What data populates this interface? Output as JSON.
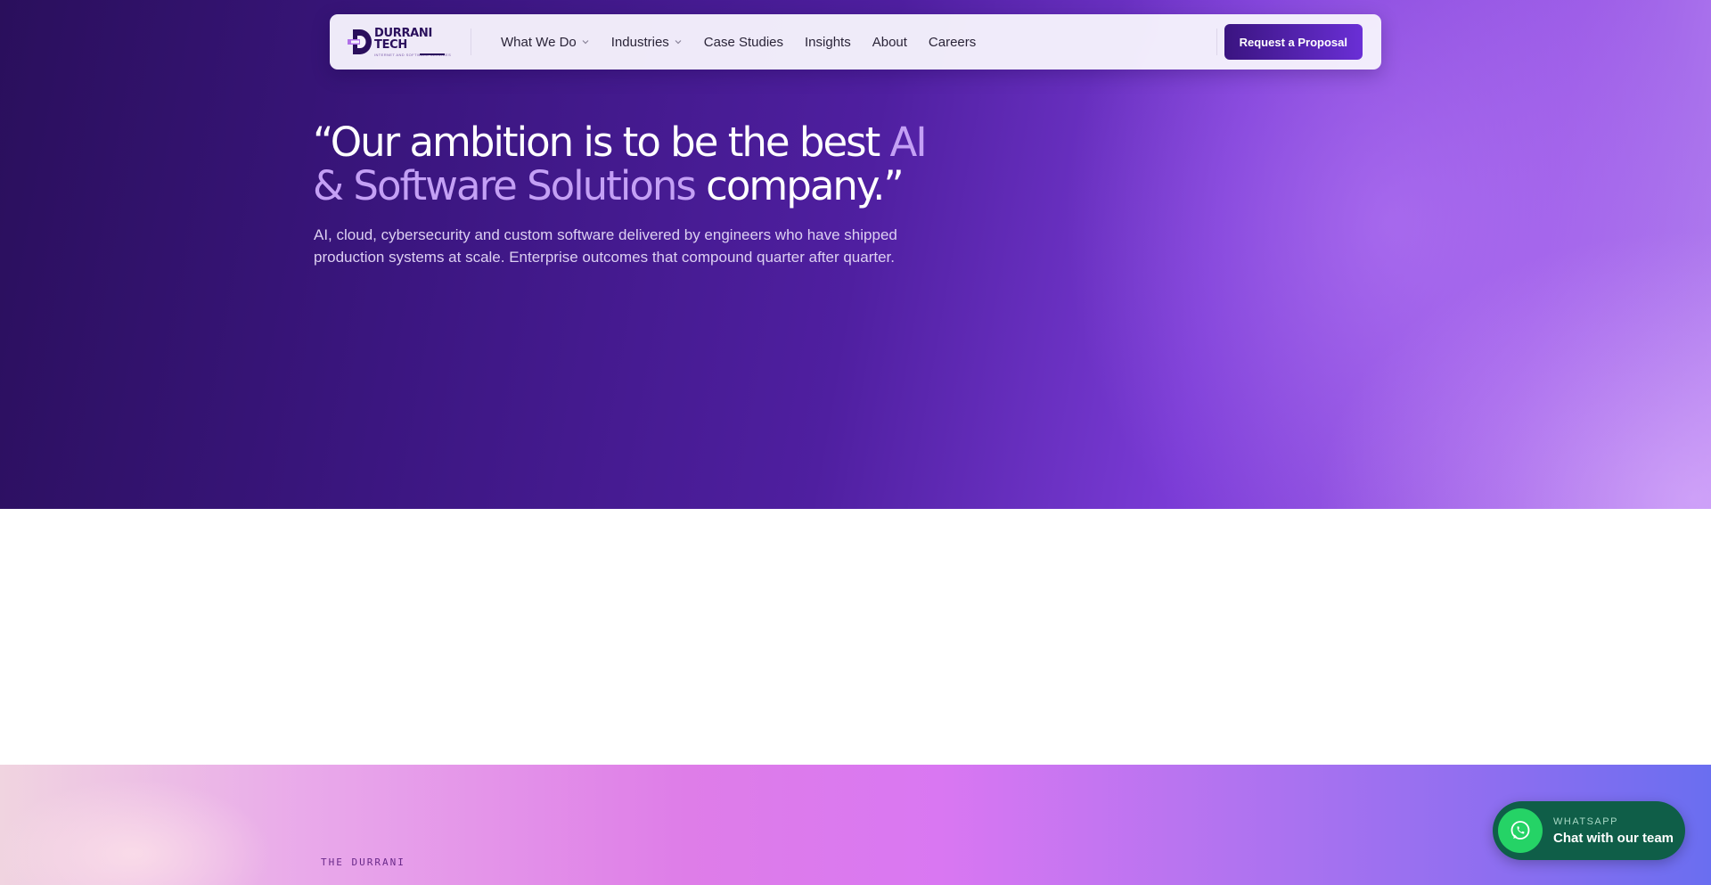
{
  "brand": {
    "name": "DURRANI TECH",
    "tagline": "INTERNET AND SOFTWARE SERVICES",
    "primary_color": "#2a0f5c",
    "accent_color": "#7a3bd6"
  },
  "nav": {
    "items": [
      {
        "label": "What We Do",
        "has_dropdown": true
      },
      {
        "label": "Industries",
        "has_dropdown": true
      },
      {
        "label": "Case Studies",
        "has_dropdown": false
      },
      {
        "label": "Insights",
        "has_dropdown": false
      },
      {
        "label": "About",
        "has_dropdown": false
      },
      {
        "label": "Careers",
        "has_dropdown": false
      }
    ],
    "cta_label": "Request a Proposal"
  },
  "hero": {
    "headline_open": "“Our ambition is to be the best ",
    "headline_accent": "AI & Software Solutions",
    "headline_close": " company.”",
    "subtext": "AI, cloud, cybersecurity and custom software delivered by engineers who have shipped production systems at scale. Enterprise outcomes that compound quarter after quarter."
  },
  "section": {
    "eyebrow": "THE DURRANI"
  },
  "whatsapp": {
    "eyebrow": "WHATSAPP",
    "label": "Chat with our team",
    "color": "#25d366"
  }
}
